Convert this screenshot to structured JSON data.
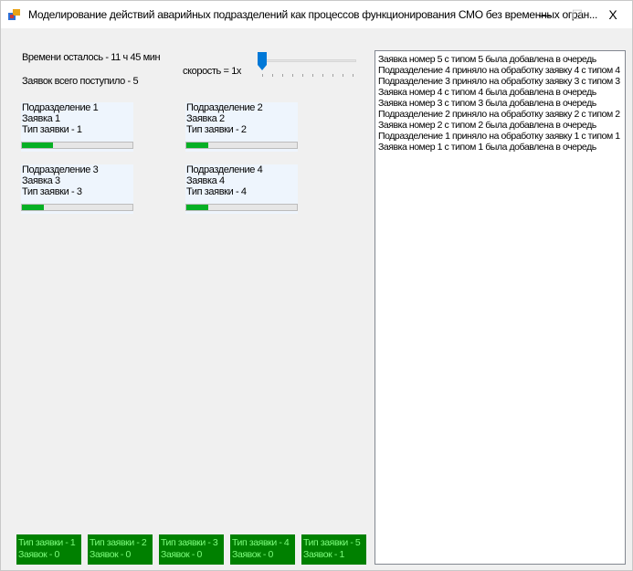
{
  "window": {
    "title": "Моделирование действий аварийных подразделений как процессов функционирования СМО без временных огран...",
    "minimize": "—",
    "maximize": "☐",
    "close": "X"
  },
  "info": {
    "time_left": "Времени осталось - 11 ч 45 мин",
    "total_requests": "Заявок всего поступило - 5",
    "speed_label": "скорость = 1x",
    "speed_level": 1
  },
  "units": [
    {
      "name": "Подразделение 1",
      "request": "Заявка 1",
      "type": "Тип заявки - 1",
      "progress": 0.28
    },
    {
      "name": "Подразделение 2",
      "request": "Заявка 2",
      "type": "Тип заявки - 2",
      "progress": 0.2
    },
    {
      "name": "Подразделение 3",
      "request": "Заявка 3",
      "type": "Тип заявки - 3",
      "progress": 0.2
    },
    {
      "name": "Подразделение 4",
      "request": "Заявка 4",
      "type": "Тип заявки - 4",
      "progress": 0.2
    }
  ],
  "log": [
    "Заявка номер 5 с типом 5 была добавлена в очередь",
    "Подразделение 4 приняло на обработку заявку 4 с типом 4",
    "Подразделение 3 приняло на обработку заявку 3 с типом 3",
    "Заявка номер 4 с типом 4 была добавлена в очередь",
    "Заявка номер 3 с типом 3 была добавлена в очередь",
    "Подразделение 2 приняло на обработку заявку 2 с типом 2",
    "Заявка номер 2 с типом 2 была добавлена в очередь",
    "Подразделение 1 приняло на обработку заявку 1 с типом 1",
    "Заявка номер 1 с типом 1 была добавлена в очередь"
  ],
  "queue_stats": [
    {
      "type": "Тип заявки - 1",
      "count": "Заявок - 0"
    },
    {
      "type": "Тип заявки - 2",
      "count": "Заявок - 0"
    },
    {
      "type": "Тип заявки - 3",
      "count": "Заявок - 0"
    },
    {
      "type": "Тип заявки - 4",
      "count": "Заявок - 0"
    },
    {
      "type": "Тип заявки - 5",
      "count": "Заявок - 1"
    }
  ],
  "colors": {
    "progress": "#06b025",
    "stat_bg": "#008000",
    "stat_text": "#7cfc7c",
    "slider": "#0078d7",
    "unit_bg": "#eef5fd"
  }
}
